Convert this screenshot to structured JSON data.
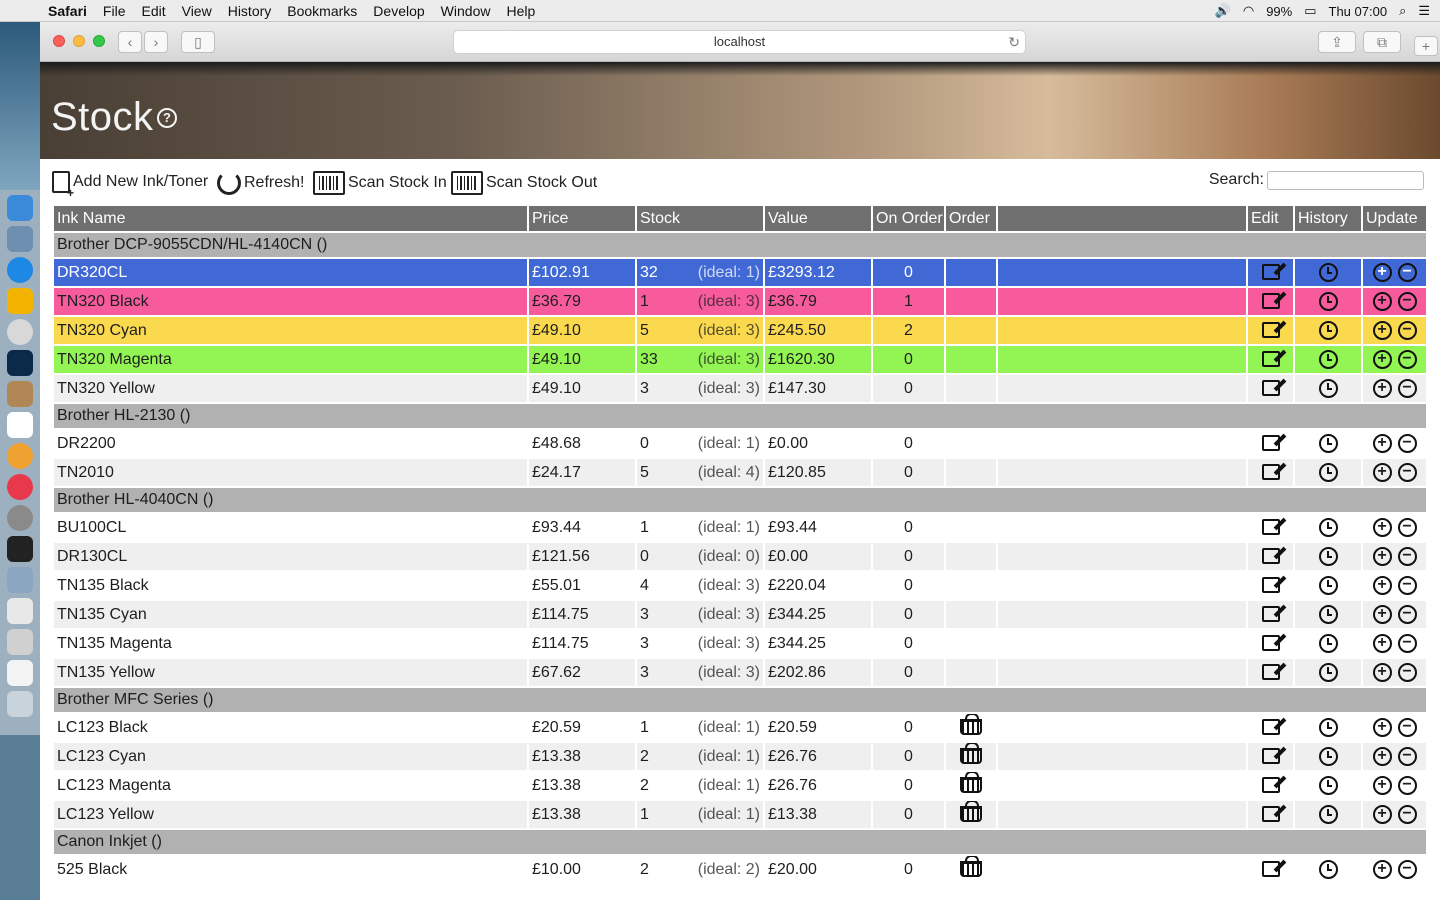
{
  "menubar": {
    "app": "Safari",
    "items": [
      "File",
      "Edit",
      "View",
      "History",
      "Bookmarks",
      "Develop",
      "Window",
      "Help"
    ],
    "battery": "99%",
    "clock": "Thu 07:00"
  },
  "browser": {
    "url": "localhost"
  },
  "page": {
    "title": "Stock",
    "help_icon": "question-circle-icon"
  },
  "toolbar": {
    "add_label": "Add New Ink/Toner",
    "refresh_label": "Refresh!",
    "scan_in_label": "Scan Stock In",
    "scan_out_label": "Scan Stock Out",
    "search_label": "Search:",
    "search_value": ""
  },
  "table": {
    "headers": [
      "Ink Name",
      "Price",
      "Stock",
      "Value",
      "On Order",
      "Order",
      "",
      "Edit",
      "History",
      "Update"
    ],
    "groups": [
      {
        "name": "Brother DCP-9055CDN/HL-4140CN ()",
        "rows": [
          {
            "name": "DR320CL",
            "price": "£102.91",
            "stock": "32",
            "ideal": "(ideal: 1)",
            "value": "£3293.12",
            "on_order": "0",
            "basket": false,
            "highlight": "blue"
          },
          {
            "name": "TN320 Black",
            "price": "£36.79",
            "stock": "1",
            "ideal": "(ideal: 3)",
            "value": "£36.79",
            "on_order": "1",
            "basket": false,
            "highlight": "pink"
          },
          {
            "name": "TN320 Cyan",
            "price": "£49.10",
            "stock": "5",
            "ideal": "(ideal: 3)",
            "value": "£245.50",
            "on_order": "2",
            "basket": false,
            "highlight": "yellow"
          },
          {
            "name": "TN320 Magenta",
            "price": "£49.10",
            "stock": "33",
            "ideal": "(ideal: 3)",
            "value": "£1620.30",
            "on_order": "0",
            "basket": false,
            "highlight": "green"
          },
          {
            "name": "TN320 Yellow",
            "price": "£49.10",
            "stock": "3",
            "ideal": "(ideal: 3)",
            "value": "£147.30",
            "on_order": "0",
            "basket": false,
            "highlight": "even"
          }
        ]
      },
      {
        "name": "Brother HL-2130 ()",
        "rows": [
          {
            "name": "DR2200",
            "price": "£48.68",
            "stock": "0",
            "ideal": "(ideal: 1)",
            "value": "£0.00",
            "on_order": "0",
            "basket": false,
            "highlight": "odd"
          },
          {
            "name": "TN2010",
            "price": "£24.17",
            "stock": "5",
            "ideal": "(ideal: 4)",
            "value": "£120.85",
            "on_order": "0",
            "basket": false,
            "highlight": "even"
          }
        ]
      },
      {
        "name": "Brother HL-4040CN ()",
        "rows": [
          {
            "name": "BU100CL",
            "price": "£93.44",
            "stock": "1",
            "ideal": "(ideal: 1)",
            "value": "£93.44",
            "on_order": "0",
            "basket": false,
            "highlight": "odd"
          },
          {
            "name": "DR130CL",
            "price": "£121.56",
            "stock": "0",
            "ideal": "(ideal: 0)",
            "value": "£0.00",
            "on_order": "0",
            "basket": false,
            "highlight": "even"
          },
          {
            "name": "TN135 Black",
            "price": "£55.01",
            "stock": "4",
            "ideal": "(ideal: 3)",
            "value": "£220.04",
            "on_order": "0",
            "basket": false,
            "highlight": "odd"
          },
          {
            "name": "TN135 Cyan",
            "price": "£114.75",
            "stock": "3",
            "ideal": "(ideal: 3)",
            "value": "£344.25",
            "on_order": "0",
            "basket": false,
            "highlight": "even"
          },
          {
            "name": "TN135 Magenta",
            "price": "£114.75",
            "stock": "3",
            "ideal": "(ideal: 3)",
            "value": "£344.25",
            "on_order": "0",
            "basket": false,
            "highlight": "odd"
          },
          {
            "name": "TN135 Yellow",
            "price": "£67.62",
            "stock": "3",
            "ideal": "(ideal: 3)",
            "value": "£202.86",
            "on_order": "0",
            "basket": false,
            "highlight": "even"
          }
        ]
      },
      {
        "name": "Brother MFC Series ()",
        "rows": [
          {
            "name": "LC123 Black",
            "price": "£20.59",
            "stock": "1",
            "ideal": "(ideal: 1)",
            "value": "£20.59",
            "on_order": "0",
            "basket": true,
            "highlight": "odd"
          },
          {
            "name": "LC123 Cyan",
            "price": "£13.38",
            "stock": "2",
            "ideal": "(ideal: 1)",
            "value": "£26.76",
            "on_order": "0",
            "basket": true,
            "highlight": "even"
          },
          {
            "name": "LC123 Magenta",
            "price": "£13.38",
            "stock": "2",
            "ideal": "(ideal: 1)",
            "value": "£26.76",
            "on_order": "0",
            "basket": true,
            "highlight": "odd"
          },
          {
            "name": "LC123 Yellow",
            "price": "£13.38",
            "stock": "1",
            "ideal": "(ideal: 1)",
            "value": "£13.38",
            "on_order": "0",
            "basket": true,
            "highlight": "even"
          }
        ]
      },
      {
        "name": "Canon Inkjet ()",
        "rows": [
          {
            "name": "525 Black",
            "price": "£10.00",
            "stock": "2",
            "ideal": "(ideal: 2)",
            "value": "£20.00",
            "on_order": "0",
            "basket": true,
            "highlight": "odd"
          }
        ]
      }
    ]
  },
  "colors": {
    "blue": "#4169d6",
    "pink": "#f75b9b",
    "yellow": "#fbd94f",
    "green": "#93f554",
    "group": "#b1b1b1",
    "header": "#6f6f6f"
  }
}
